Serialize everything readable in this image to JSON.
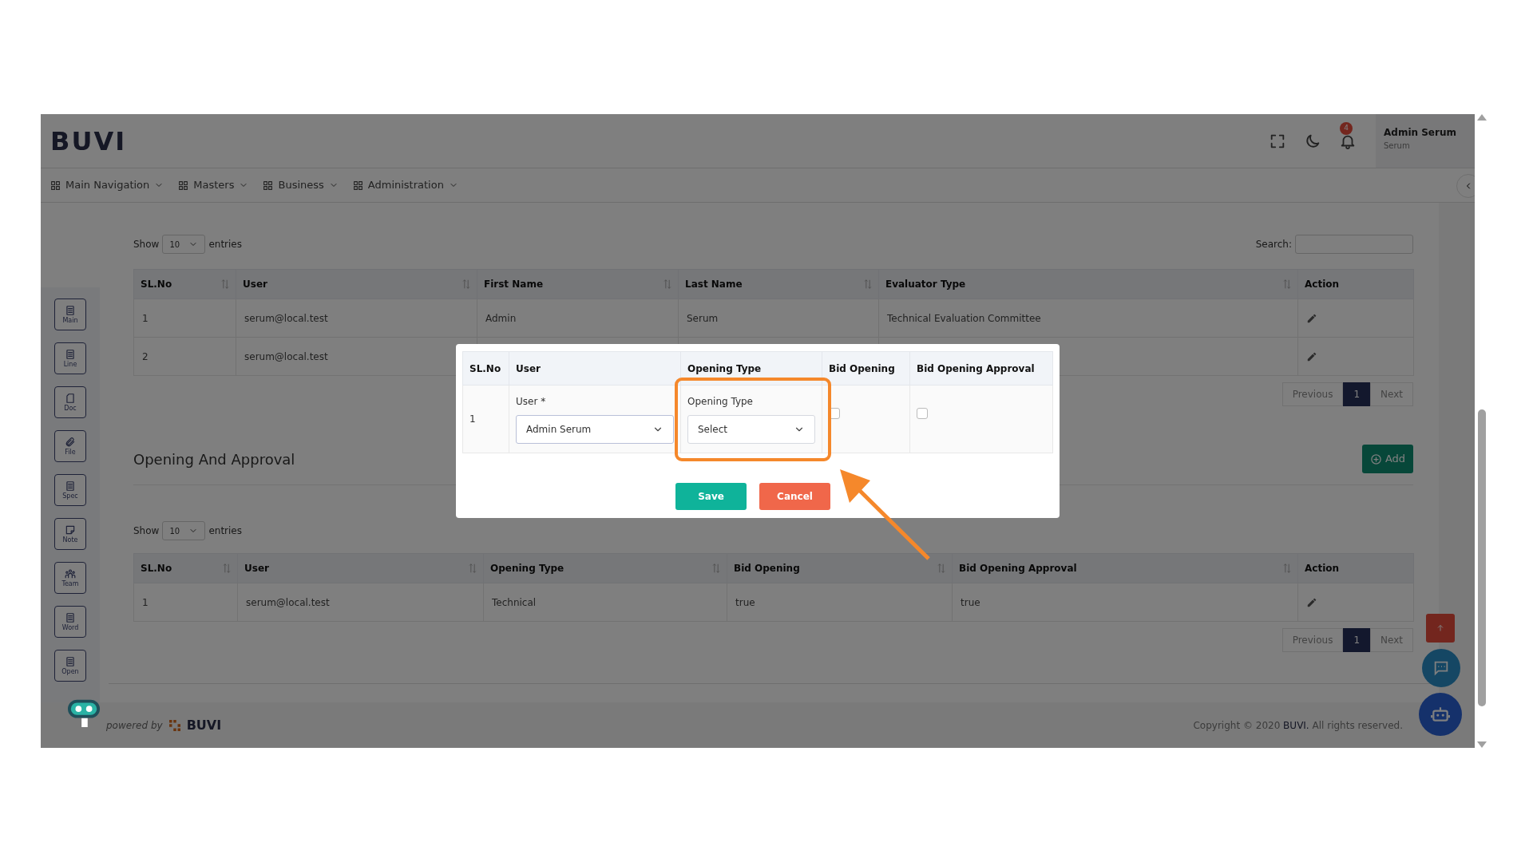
{
  "header": {
    "logo": "BUVI",
    "notification_count": "4",
    "user_name": "Admin Serum",
    "user_role": "Serum"
  },
  "nav": [
    {
      "label": "Main Navigation"
    },
    {
      "label": "Masters"
    },
    {
      "label": "Business"
    },
    {
      "label": "Administration"
    }
  ],
  "sidebar": [
    {
      "label": "Main",
      "kind": "list"
    },
    {
      "label": "Line",
      "kind": "list"
    },
    {
      "label": "Doc",
      "kind": "page"
    },
    {
      "label": "File",
      "kind": "clip"
    },
    {
      "label": "Spec",
      "kind": "list"
    },
    {
      "label": "Note",
      "kind": "note"
    },
    {
      "label": "Team",
      "kind": "team"
    },
    {
      "label": "Word",
      "kind": "list"
    },
    {
      "label": "Open",
      "kind": "list"
    }
  ],
  "evaluators": {
    "show": "Show",
    "length": "10",
    "entries": "entries",
    "search_label": "Search:",
    "columns": [
      "SL.No",
      "User",
      "First Name",
      "Last Name",
      "Evaluator Type",
      "Action"
    ],
    "rows": [
      {
        "sl_no": "1",
        "user": "serum@local.test",
        "first_name": "Admin",
        "last_name": "Serum",
        "evaluator_type": "Technical Evaluation Committee"
      },
      {
        "sl_no": "2",
        "user": "serum@local.test"
      }
    ],
    "pagination": {
      "previous": "Previous",
      "pages": [
        {
          "label": "1",
          "selected": true
        }
      ],
      "next": "Next"
    }
  },
  "opening": {
    "title": "Opening And Approval",
    "add_label": "Add",
    "show": "Show",
    "length": "10",
    "entries": "entries",
    "columns": [
      "SL.No",
      "User",
      "Opening Type",
      "Bid Opening",
      "Bid Opening Approval",
      "Action"
    ],
    "rows": [
      {
        "sl_no": "1",
        "user": "serum@local.test",
        "opening_type": "Technical",
        "bid_opening": "true",
        "bid_opening_approval": "true"
      }
    ],
    "pagination": {
      "previous": "Previous",
      "pages": [
        {
          "label": "1",
          "selected": true
        }
      ],
      "next": "Next"
    }
  },
  "footer": {
    "powered_by": "powered by",
    "brand": "BUVI",
    "copyright_before": "Copyright © 2020",
    "copyright_link": "BUVI.",
    "copyright_after": "All rights reserved."
  },
  "modal": {
    "columns": [
      "SL.No",
      "User",
      "Opening Type",
      "Bid Opening",
      "Bid Opening Approval"
    ],
    "row": {
      "sl_no": "1",
      "user_label": "User *",
      "user_value": "Admin Serum",
      "type_label": "Opening Type",
      "type_value": "Select",
      "bid_opening": {
        "checked": false
      },
      "bid_opening_approval": {
        "checked": false
      }
    },
    "buttons": [
      {
        "label": "Save",
        "kind": "primary"
      },
      {
        "label": "Cancel",
        "kind": "danger"
      }
    ]
  }
}
